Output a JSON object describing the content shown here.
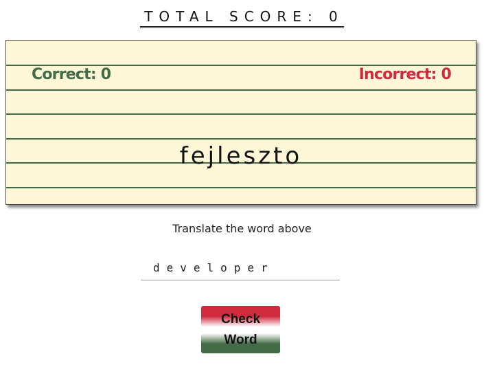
{
  "header": {
    "total_score_label": "TOTAL SCORE:",
    "total_score_value": "0"
  },
  "card": {
    "correct_label": "Correct:",
    "correct_value": "0",
    "incorrect_label": "Incorrect:",
    "incorrect_value": "0",
    "word": "fejleszto"
  },
  "instruction": "Translate the word above",
  "answer": {
    "value": "developer"
  },
  "check_button": {
    "line1": "Check",
    "line2": "Word"
  },
  "colors": {
    "correct": "#436b46",
    "incorrect": "#cf2a3e",
    "card_background": "#fdf7d8"
  }
}
